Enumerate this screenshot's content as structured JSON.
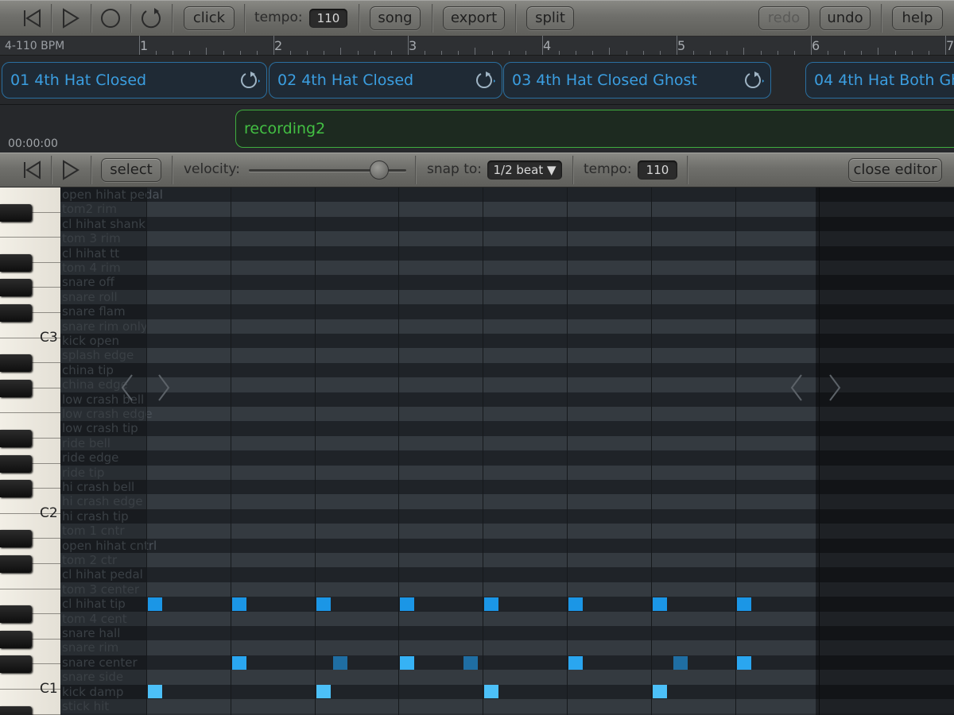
{
  "toolbar": {
    "click_label": "click",
    "tempo_label": "tempo:",
    "tempo_value": "110",
    "song_label": "song",
    "export_label": "export",
    "split_label": "split",
    "redo_label": "redo",
    "undo_label": "undo",
    "help_label": "help"
  },
  "ruler": {
    "bpm_label": "4-110 BPM",
    "bars": [
      "1",
      "2",
      "3",
      "4",
      "5",
      "6",
      "7"
    ]
  },
  "tracks": {
    "regions": [
      "01 4th Hat Closed",
      "02 4th Hat Closed",
      "03 4th Hat Closed Ghost",
      "04 4th Hat Both Gh"
    ],
    "audio_region": "recording2",
    "timecode": "00:00:00"
  },
  "editor": {
    "select_label": "select",
    "velocity_label": "velocity:",
    "velocity_level": 0.83,
    "snap_label": "snap to:",
    "snap_value": "1/2 beat ▼",
    "tempo_label": "tempo:",
    "tempo_value": "110",
    "close_label": "close editor"
  },
  "keyboard": {
    "octaves": [
      "C3",
      "C2",
      "C1"
    ]
  },
  "rows": [
    "open hihat pedal",
    "tom2 rim",
    "cl hihat shank",
    "tom 3 rim",
    "cl hihat tt",
    "tom 4 rim",
    "snare off",
    "snare roll",
    "snare flam",
    "snare rim only",
    "kick open",
    "splash edge",
    "china tip",
    "china edge",
    "low crash bell",
    "low crash edge",
    "low crash tip",
    "ride bell",
    "ride edge",
    "ride tip",
    "hi crash bell",
    "hi crash edge",
    "hi crash tip",
    "tom 1 cntr",
    "open hihat cntrl",
    "tom 2 ctr",
    "cl hihat pedal",
    "tom 3 center",
    "cl hihat tip",
    "tom 4 cent",
    "snare hall",
    "snare rim",
    "snare center",
    "snare side",
    "kick damp",
    "stick hit"
  ],
  "notes": [
    {
      "row": 28,
      "step": 0,
      "color": "#1b96e6"
    },
    {
      "row": 28,
      "step": 2,
      "color": "#1b96e6"
    },
    {
      "row": 28,
      "step": 4,
      "color": "#1b96e6"
    },
    {
      "row": 28,
      "step": 6,
      "color": "#1b96e6"
    },
    {
      "row": 28,
      "step": 8,
      "color": "#1b96e6"
    },
    {
      "row": 28,
      "step": 10,
      "color": "#1b96e6"
    },
    {
      "row": 28,
      "step": 12,
      "color": "#1b96e6"
    },
    {
      "row": 28,
      "step": 14,
      "color": "#1b96e6"
    },
    {
      "row": 32,
      "step": 2,
      "color": "#2aa6f0"
    },
    {
      "row": 32,
      "step": 4.4,
      "color": "#1f6ea3"
    },
    {
      "row": 32,
      "step": 6,
      "color": "#36b2f5"
    },
    {
      "row": 32,
      "step": 7.5,
      "color": "#1f6ea3"
    },
    {
      "row": 32,
      "step": 10,
      "color": "#2aa6f0"
    },
    {
      "row": 32,
      "step": 12.5,
      "color": "#1f6ea3"
    },
    {
      "row": 32,
      "step": 14,
      "color": "#2aa6f0"
    },
    {
      "row": 34,
      "step": 0,
      "color": "#4cc0f8"
    },
    {
      "row": 34,
      "step": 4,
      "color": "#4cc0f8"
    },
    {
      "row": 34,
      "step": 8,
      "color": "#4cc0f8"
    },
    {
      "row": 34,
      "step": 12,
      "color": "#4cc0f8"
    }
  ]
}
